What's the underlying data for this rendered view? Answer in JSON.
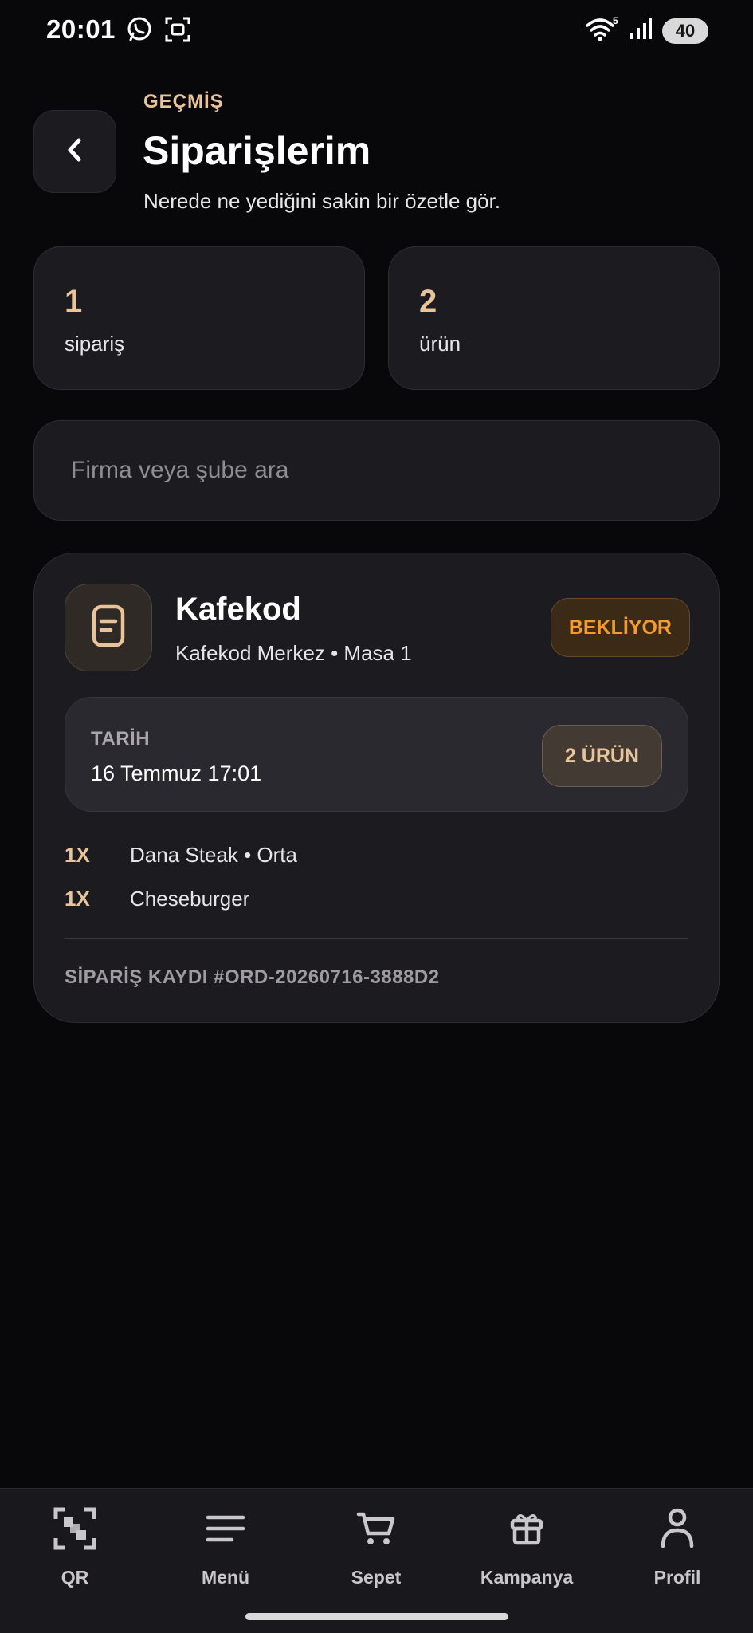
{
  "status_bar": {
    "time": "20:01",
    "battery": "40",
    "icons": [
      "whatsapp-icon",
      "screenshot-icon",
      "wifi-icon",
      "signal-icon",
      "battery-icon"
    ]
  },
  "header": {
    "eyebrow": "GEÇMİŞ",
    "title": "Siparişlerim",
    "subtitle": "Nerede ne yediğini sakin bir özetle gör."
  },
  "stats": [
    {
      "value": "1",
      "label": "sipariş"
    },
    {
      "value": "2",
      "label": "ürün"
    }
  ],
  "search": {
    "placeholder": "Firma veya şube ara",
    "value": ""
  },
  "order": {
    "store_name": "Kafekod",
    "store_sub": "Kafekod Merkez • Masa 1",
    "status": "BEKLİYOR",
    "date_label": "TARİH",
    "date_value": "16 Temmuz 17:01",
    "item_count": "2 ÜRÜN",
    "items": [
      {
        "qty": "1X",
        "name": "Dana Steak • Orta"
      },
      {
        "qty": "1X",
        "name": "Cheseburger"
      }
    ],
    "reference": "SİPARİŞ KAYDI #ORD-20260716-3888D2"
  },
  "nav": [
    {
      "label": "QR",
      "icon": "qr-scan-icon"
    },
    {
      "label": "Menü",
      "icon": "menu-icon"
    },
    {
      "label": "Sepet",
      "icon": "cart-icon"
    },
    {
      "label": "Kampanya",
      "icon": "gift-icon"
    },
    {
      "label": "Profil",
      "icon": "profile-icon"
    }
  ],
  "colors": {
    "background": "#08080b",
    "card": "#1c1b20",
    "accent": "#e9c49a",
    "status_pending": "#f59a2b"
  }
}
